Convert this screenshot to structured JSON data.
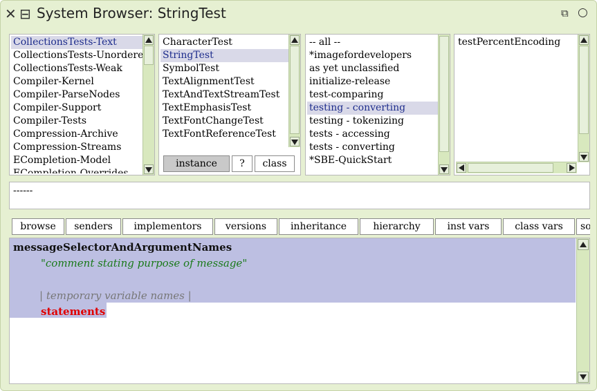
{
  "window": {
    "title": "System Browser: StringTest"
  },
  "packages": {
    "items": [
      "CollectionsTests-Text",
      "CollectionsTests-Unordered",
      "CollectionsTests-Weak",
      "Compiler-Kernel",
      "Compiler-ParseNodes",
      "Compiler-Support",
      "Compiler-Tests",
      "Compression-Archive",
      "Compression-Streams",
      "ECompletion-Model",
      "ECompletion-Overrides"
    ]
  },
  "classes": {
    "items": [
      "CharacterTest",
      "StringTest",
      "SymbolTest",
      "TextAlignmentTest",
      "TextAndTextStreamTest",
      "TextEmphasisTest",
      "TextFontChangeTest",
      "TextFontReferenceTest"
    ],
    "switches": {
      "instance": "instance",
      "help": "?",
      "class": "class"
    }
  },
  "protocols": {
    "items": [
      "-- all --",
      "*imagefordevelopers",
      "as yet unclassified",
      "initialize-release",
      "test-comparing",
      "testing - converting",
      "testing - tokenizing",
      "tests - accessing",
      "tests - converting",
      "*SBE-QuickStart"
    ]
  },
  "methods": {
    "items": [
      "testPercentEncoding"
    ]
  },
  "message_line": "------",
  "toolbar": {
    "buttons": [
      "browse",
      "senders",
      "implementors",
      "versions",
      "inheritance",
      "hierarchy",
      "inst vars",
      "class vars",
      "source"
    ]
  },
  "code": {
    "selector": "messageSelectorAndArgumentNames",
    "comment": "\"comment stating purpose of message\"",
    "temps": "| temporary variable names |",
    "statements": "statements"
  },
  "colors": {
    "window_bg": "#e6f0d2",
    "selection_bg": "#d9d9e8",
    "selection_text": "#1d2c8c",
    "code_highlight": "#bdbfe2",
    "comment": "#1a7a1a",
    "statements": "#e00000"
  }
}
